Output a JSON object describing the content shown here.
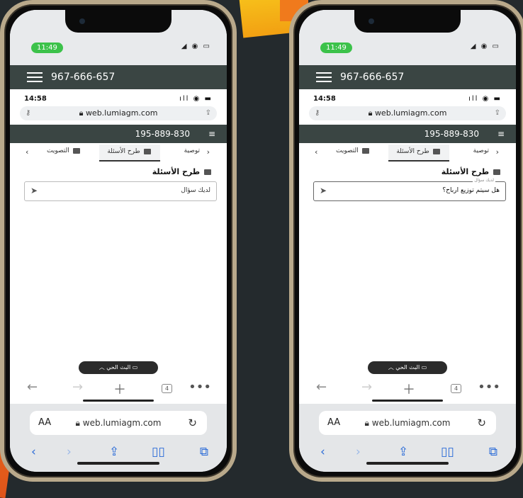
{
  "colors": {
    "app_header": "#3a4543",
    "status_pill": "#3cc24a",
    "safari_blue": "#2a6bd8"
  },
  "phones": [
    {
      "status_time": "11:49",
      "app_phone": "967-666-657",
      "inner_time": "14:58",
      "url": "web.lumiagm.com",
      "site_phone": "195-889-830",
      "tabs": {
        "recommendation": "توصية",
        "ask": "طرح الأسئلة",
        "vote": "التصويت"
      },
      "section_title": "طرح الأسئلة",
      "question_placeholder": "لديك سؤال",
      "question_label": "",
      "question_value": "",
      "live_label": "البث الحي",
      "tab_count": "4",
      "bottom_aa": "AA",
      "bottom_url": "web.lumiagm.com"
    },
    {
      "status_time": "11:49",
      "app_phone": "967-666-657",
      "inner_time": "14:58",
      "url": "web.lumiagm.com",
      "site_phone": "195-889-830",
      "tabs": {
        "recommendation": "توصية",
        "ask": "طرح الأسئلة",
        "vote": "التصويت"
      },
      "section_title": "طرح الأسئلة",
      "question_placeholder": "",
      "question_label": "لديك سؤال",
      "question_value": "هل سيتم توزيع ارباح؟",
      "live_label": "البث الحي",
      "tab_count": "4",
      "bottom_aa": "AA",
      "bottom_url": "web.lumiagm.com"
    }
  ]
}
